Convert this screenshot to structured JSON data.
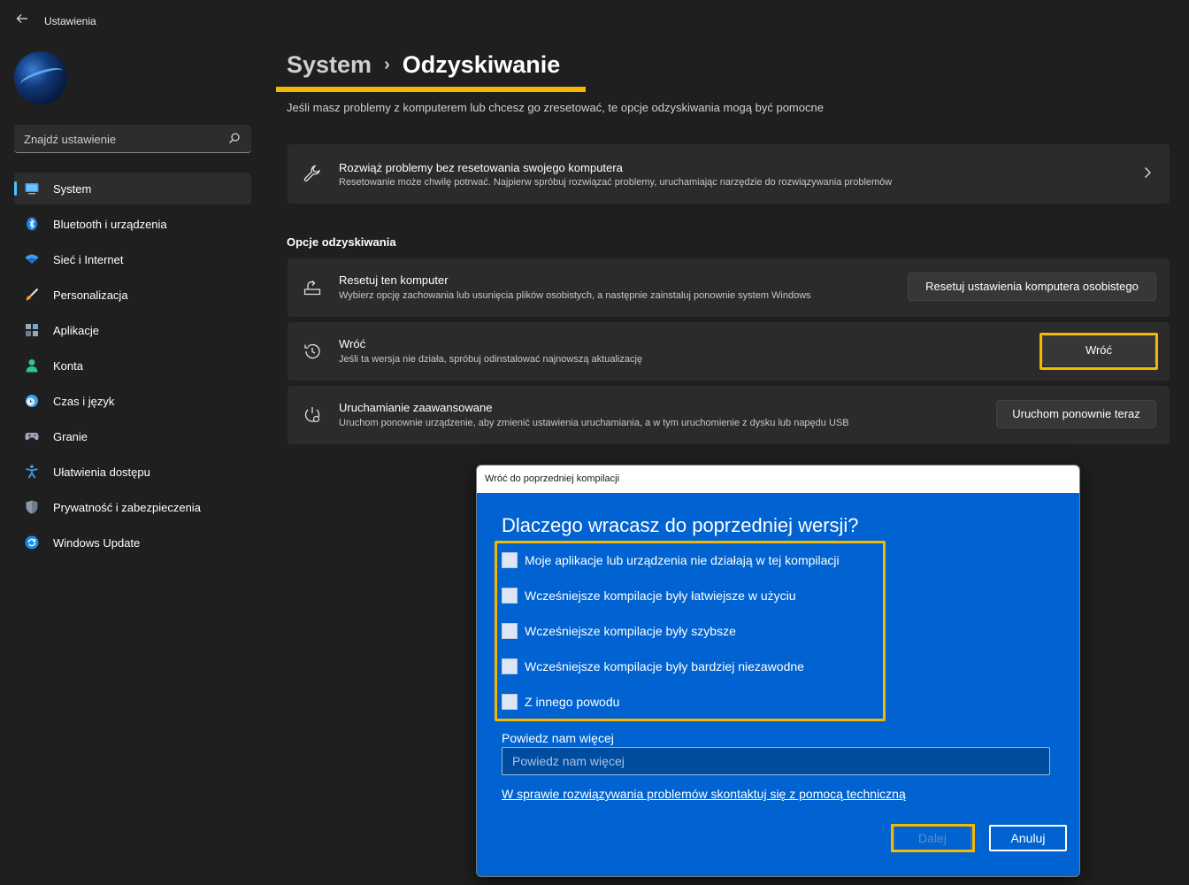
{
  "app": {
    "title": "Ustawienia"
  },
  "sidebar": {
    "search_placeholder": "Znajdź ustawienie",
    "items": [
      {
        "label": "System",
        "icon": "monitor-icon",
        "active": true
      },
      {
        "label": "Bluetooth i urządzenia",
        "icon": "bluetooth-icon"
      },
      {
        "label": "Sieć i Internet",
        "icon": "wifi-icon"
      },
      {
        "label": "Personalizacja",
        "icon": "brush-icon"
      },
      {
        "label": "Aplikacje",
        "icon": "apps-icon"
      },
      {
        "label": "Konta",
        "icon": "person-icon"
      },
      {
        "label": "Czas i język",
        "icon": "clock-globe-icon"
      },
      {
        "label": "Granie",
        "icon": "gamepad-icon"
      },
      {
        "label": "Ułatwienia dostępu",
        "icon": "accessibility-icon"
      },
      {
        "label": "Prywatność i zabezpieczenia",
        "icon": "shield-icon"
      },
      {
        "label": "Windows Update",
        "icon": "update-icon"
      }
    ]
  },
  "header": {
    "crumb_parent": "System",
    "crumb_current": "Odzyskiwanie",
    "subtitle": "Jeśli masz problemy z komputerem lub chcesz go zresetować, te opcje odzyskiwania mogą być pomocne"
  },
  "troubleshoot": {
    "title": "Rozwiąż problemy bez resetowania swojego komputera",
    "desc": "Resetowanie może chwilę potrwać. Najpierw spróbuj rozwiązać problemy, uruchamiając narzędzie do rozwiązywania problemów"
  },
  "recovery": {
    "heading": "Opcje odzyskiwania",
    "items": [
      {
        "title": "Resetuj ten komputer",
        "desc": "Wybierz opcję zachowania lub usunięcia plików osobistych, a następnie zainstaluj ponownie system Windows",
        "button": "Resetuj ustawienia komputera osobistego"
      },
      {
        "title": "Wróć",
        "desc": "Jeśli ta wersja nie działa, spróbuj odinstalować najnowszą aktualizację",
        "button": "Wróć"
      },
      {
        "title": "Uruchamianie zaawansowane",
        "desc": "Uruchom ponownie urządzenie, aby zmienić ustawienia uruchamiania, a w tym uruchomienie z dysku lub napędu USB",
        "button": "Uruchom ponownie teraz"
      }
    ]
  },
  "dialog": {
    "title": "Wróć do poprzedniej kompilacji",
    "heading": "Dlaczego wracasz do poprzedniej wersji?",
    "options": [
      "Moje aplikacje lub urządzenia nie działają w tej kompilacji",
      "Wcześniejsze kompilacje były łatwiejsze w użyciu",
      "Wcześniejsze kompilacje były szybsze",
      "Wcześniejsze kompilacje były bardziej niezawodne",
      "Z innego powodu"
    ],
    "more_label": "Powiedz nam więcej",
    "more_placeholder": "Powiedz nam więcej",
    "support_link": "W sprawie rozwiązywania problemów skontaktuj się z pomocą techniczną",
    "next_label": "Dalej",
    "cancel_label": "Anuluj"
  },
  "colors": {
    "highlight": "#f5b800",
    "accent": "#4cc2ff",
    "dialog_bg": "#0063d1"
  }
}
